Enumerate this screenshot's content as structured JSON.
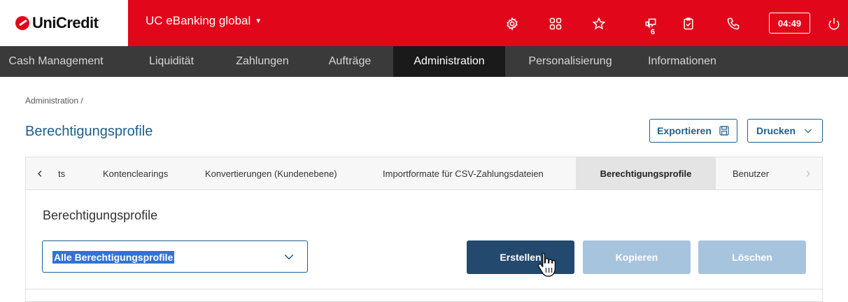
{
  "brand": {
    "logo_text": "UniCredit",
    "primary_color": "#e2061a",
    "accent_color": "#1d5f8c"
  },
  "header": {
    "app_title": "UC eBanking global",
    "icons": [
      "gear-icon",
      "apps-grid-icon",
      "star-icon",
      "messages-icon",
      "clipboard-icon",
      "phone-icon",
      "power-icon"
    ],
    "message_count": "6",
    "session_timer": "04:49"
  },
  "nav": {
    "items": [
      {
        "label": "Cash Management"
      },
      {
        "label": "Liquidität"
      },
      {
        "label": "Zahlungen"
      },
      {
        "label": "Aufträge"
      },
      {
        "label": "Administration"
      },
      {
        "label": "Personalisierung"
      },
      {
        "label": "Informationen"
      }
    ],
    "active": "Administration"
  },
  "breadcrumb": "Administration /",
  "page": {
    "title": "Berechtigungsprofile",
    "export_label": "Exportieren",
    "print_label": "Drucken"
  },
  "tabs": {
    "items": [
      {
        "label": "ts"
      },
      {
        "label": "Kontenclearings"
      },
      {
        "label": "Konvertierungen (Kundenebene)"
      },
      {
        "label": "Importformate für CSV-Zahlungsdateien"
      },
      {
        "label": "Berechtigungsprofile"
      },
      {
        "label": "Benutzer"
      }
    ],
    "active": "Berechtigungsprofile"
  },
  "content": {
    "section_title": "Berechtigungsprofile",
    "filter_select": {
      "value": "Alle Berechtigungsprofile"
    },
    "actions": {
      "create_label": "Erstellen",
      "copy_label": "Kopieren",
      "delete_label": "Löschen"
    }
  }
}
